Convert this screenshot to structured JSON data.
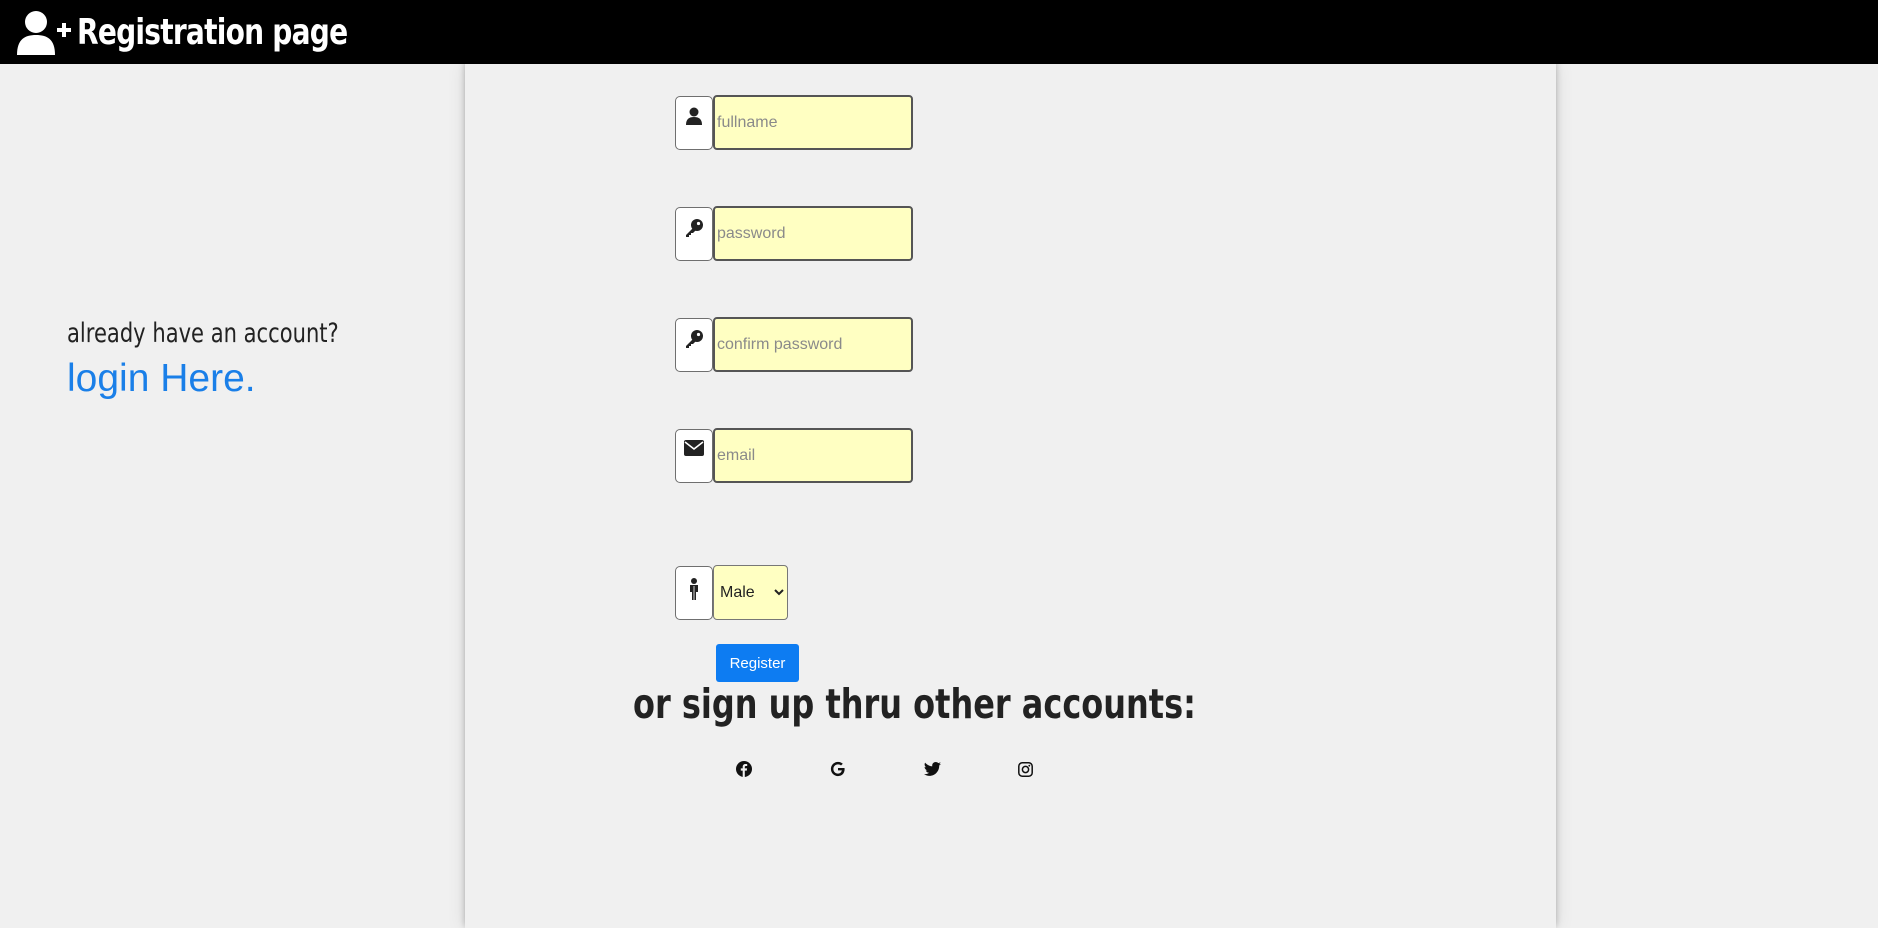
{
  "header": {
    "title": "Registration page",
    "icon": "user-plus-icon"
  },
  "sidebar": {
    "prompt": "already have an account?",
    "login_link": "login Here."
  },
  "form": {
    "fullname": {
      "placeholder": "fullname",
      "icon": "user-icon"
    },
    "password": {
      "placeholder": "password",
      "icon": "key-icon"
    },
    "confirm_password": {
      "placeholder": "confirm password",
      "icon": "key-icon"
    },
    "email": {
      "placeholder": "email",
      "icon": "envelope-icon"
    },
    "gender": {
      "selected": "Male",
      "icon": "person-icon"
    },
    "register_label": "Register"
  },
  "social": {
    "heading": "or sign up thru other accounts:",
    "icons": [
      "facebook-icon",
      "google-icon",
      "twitter-icon",
      "instagram-icon"
    ]
  },
  "colors": {
    "header_bg": "#000000",
    "page_bg": "#f0f0f0",
    "input_bg": "#ffffc2",
    "link": "#1a7fe8",
    "button": "#0d7cf2"
  }
}
